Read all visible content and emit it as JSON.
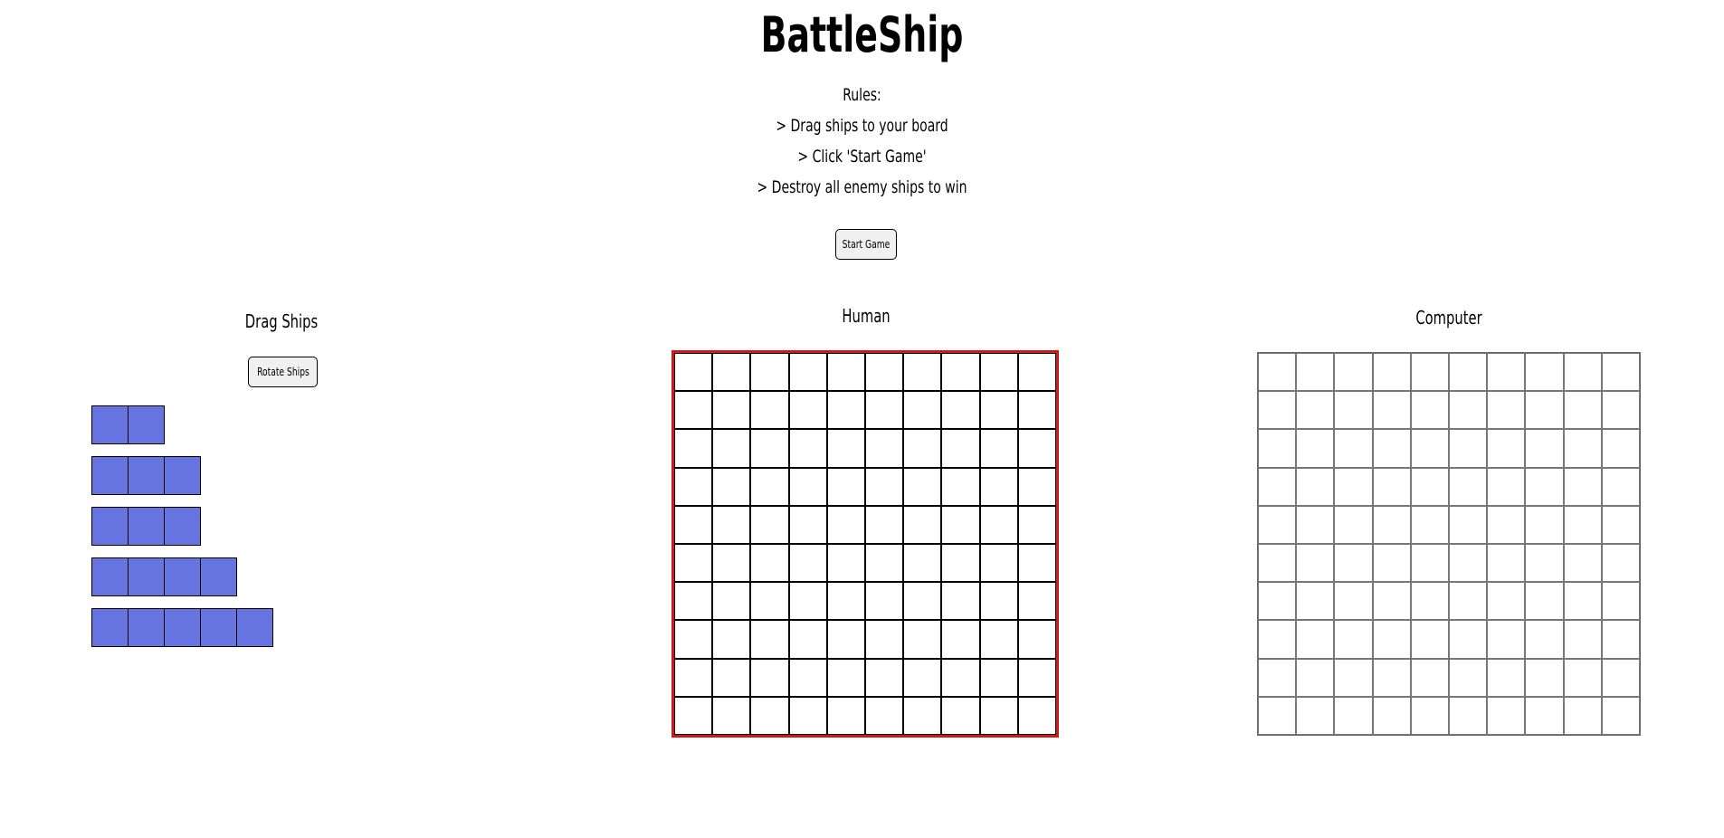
{
  "title": "BattleShip",
  "rules": {
    "heading": "Rules:",
    "items": [
      "> Drag ships to your board",
      "> Click 'Start Game'",
      "> Destroy all enemy ships to win"
    ]
  },
  "buttons": {
    "start": "Start Game",
    "rotate": "Rotate Ships"
  },
  "sections": {
    "drag_ships": "Drag Ships",
    "human": "Human",
    "computer": "Computer"
  },
  "ships": [
    {
      "length": 2
    },
    {
      "length": 3
    },
    {
      "length": 3
    },
    {
      "length": 4
    },
    {
      "length": 5
    }
  ],
  "boards": {
    "rows": 10,
    "cols": 10
  },
  "colors": {
    "ship": "#6674e0",
    "human_board_border": "#d01818",
    "computer_grid": "#777777"
  }
}
